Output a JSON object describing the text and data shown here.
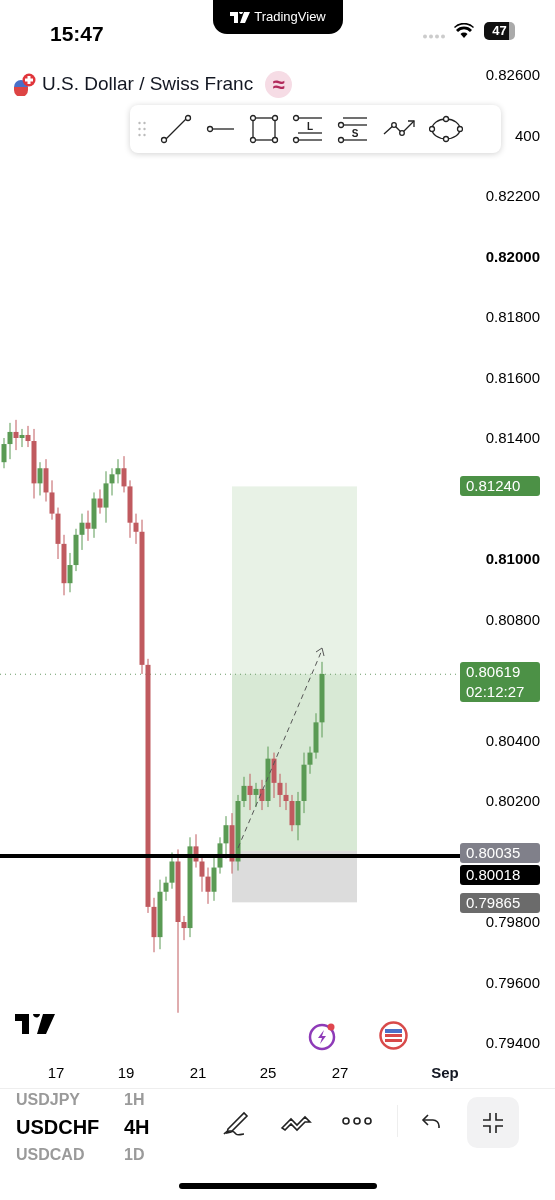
{
  "status_bar": {
    "time": "15:47",
    "app_pill": "TradingView",
    "battery": "47"
  },
  "header": {
    "title": "U.S. Dollar / Swiss Franc",
    "badge": "≈"
  },
  "drawing_toolbar": {
    "long_letter": "L",
    "short_letter": "S"
  },
  "price_axis": [
    {
      "label": "0.82600",
      "major": false
    },
    {
      "label": "400",
      "major": false
    },
    {
      "label": "0.82200",
      "major": false
    },
    {
      "label": "0.82000",
      "major": true
    },
    {
      "label": "0.81800",
      "major": false
    },
    {
      "label": "0.81600",
      "major": false
    },
    {
      "label": "0.81400",
      "major": false
    },
    {
      "label": "0.81000",
      "major": true
    },
    {
      "label": "0.80800",
      "major": false
    },
    {
      "label": "0.80400",
      "major": false
    },
    {
      "label": "0.80200",
      "major": false
    },
    {
      "label": "0.79800",
      "major": false
    },
    {
      "label": "0.79600",
      "major": false
    },
    {
      "label": "0.79400",
      "major": false
    }
  ],
  "price_tags": [
    {
      "kind": "target",
      "label": "0.81240"
    },
    {
      "kind": "current",
      "label": "0.80619",
      "countdown": "02:12:27"
    },
    {
      "kind": "entry",
      "label": "0.80035"
    },
    {
      "kind": "line",
      "label": "0.80018"
    },
    {
      "kind": "stop",
      "label": "0.79865"
    }
  ],
  "time_axis": [
    {
      "label": "17",
      "bold": false
    },
    {
      "label": "19",
      "bold": false
    },
    {
      "label": "21",
      "bold": false
    },
    {
      "label": "25",
      "bold": false
    },
    {
      "label": "27",
      "bold": false
    },
    {
      "label": "Sep",
      "bold": true
    }
  ],
  "symbols": [
    {
      "label": "USDJPY",
      "selected": false
    },
    {
      "label": "USDCHF",
      "selected": true
    },
    {
      "label": "USDCAD",
      "selected": false
    }
  ],
  "timeframes": [
    {
      "label": "1H",
      "selected": false
    },
    {
      "label": "4H",
      "selected": true
    },
    {
      "label": "1D",
      "selected": false
    }
  ]
}
